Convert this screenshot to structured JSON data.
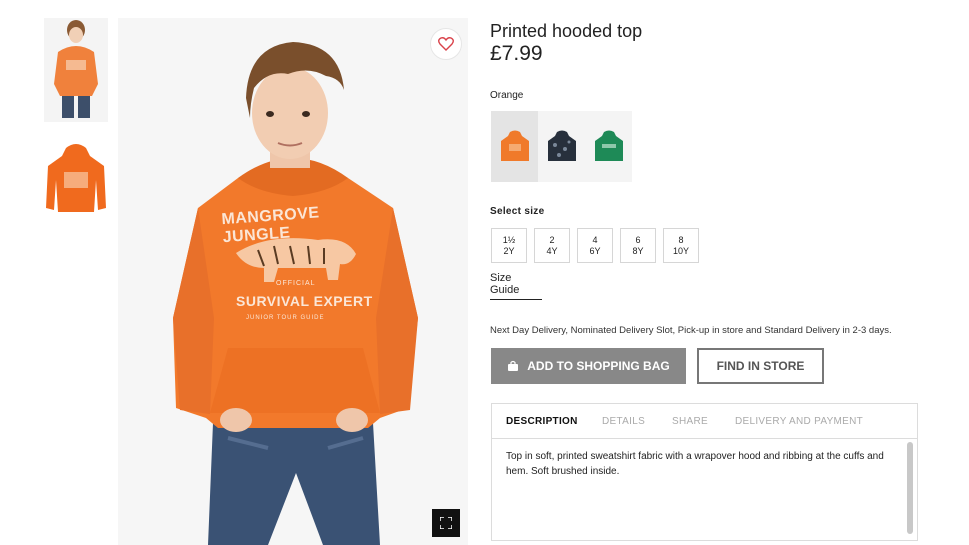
{
  "product": {
    "title": "Printed hooded top",
    "price": "£7.99",
    "color_selected": "Orange",
    "hoodie_print": {
      "line1": "MANGROVE JUNGLE",
      "line2": "OFFICIAL",
      "line3": "SURVIVAL EXPERT",
      "line4": "JUNIOR TOUR GUIDE"
    }
  },
  "swatches": [
    {
      "name": "orange",
      "color": "#f07a2a"
    },
    {
      "name": "navy",
      "color": "#27303c"
    },
    {
      "name": "green",
      "color": "#1e8a57"
    }
  ],
  "sizes": {
    "label": "Select size",
    "options": [
      {
        "top": "1½",
        "bottom": "2Y"
      },
      {
        "top": "2",
        "bottom": "4Y"
      },
      {
        "top": "4",
        "bottom": "6Y"
      },
      {
        "top": "6",
        "bottom": "8Y"
      },
      {
        "top": "8",
        "bottom": "10Y"
      }
    ],
    "guide_label": "Size Guide"
  },
  "delivery_text": "Next Day Delivery, Nominated Delivery Slot, Pick-up in store and Standard Delivery in 2-3 days.",
  "buttons": {
    "add_to_bag": "ADD TO SHOPPING BAG",
    "find_in_store": "FIND IN STORE"
  },
  "tabs": {
    "items": [
      "DESCRIPTION",
      "DETAILS",
      "SHARE",
      "DELIVERY AND PAYMENT"
    ],
    "active": "DESCRIPTION",
    "description": "Top in soft, printed sweatshirt fabric with a wrapover hood and ribbing at the cuffs and hem. Soft brushed inside."
  },
  "icons": {
    "favorite": "heart-icon",
    "zoom": "expand-icon",
    "bag": "shopping-bag-icon"
  },
  "colors": {
    "accent_orange": "#f07a2a",
    "button_gray": "#888888",
    "heart_red": "#d9424a"
  }
}
